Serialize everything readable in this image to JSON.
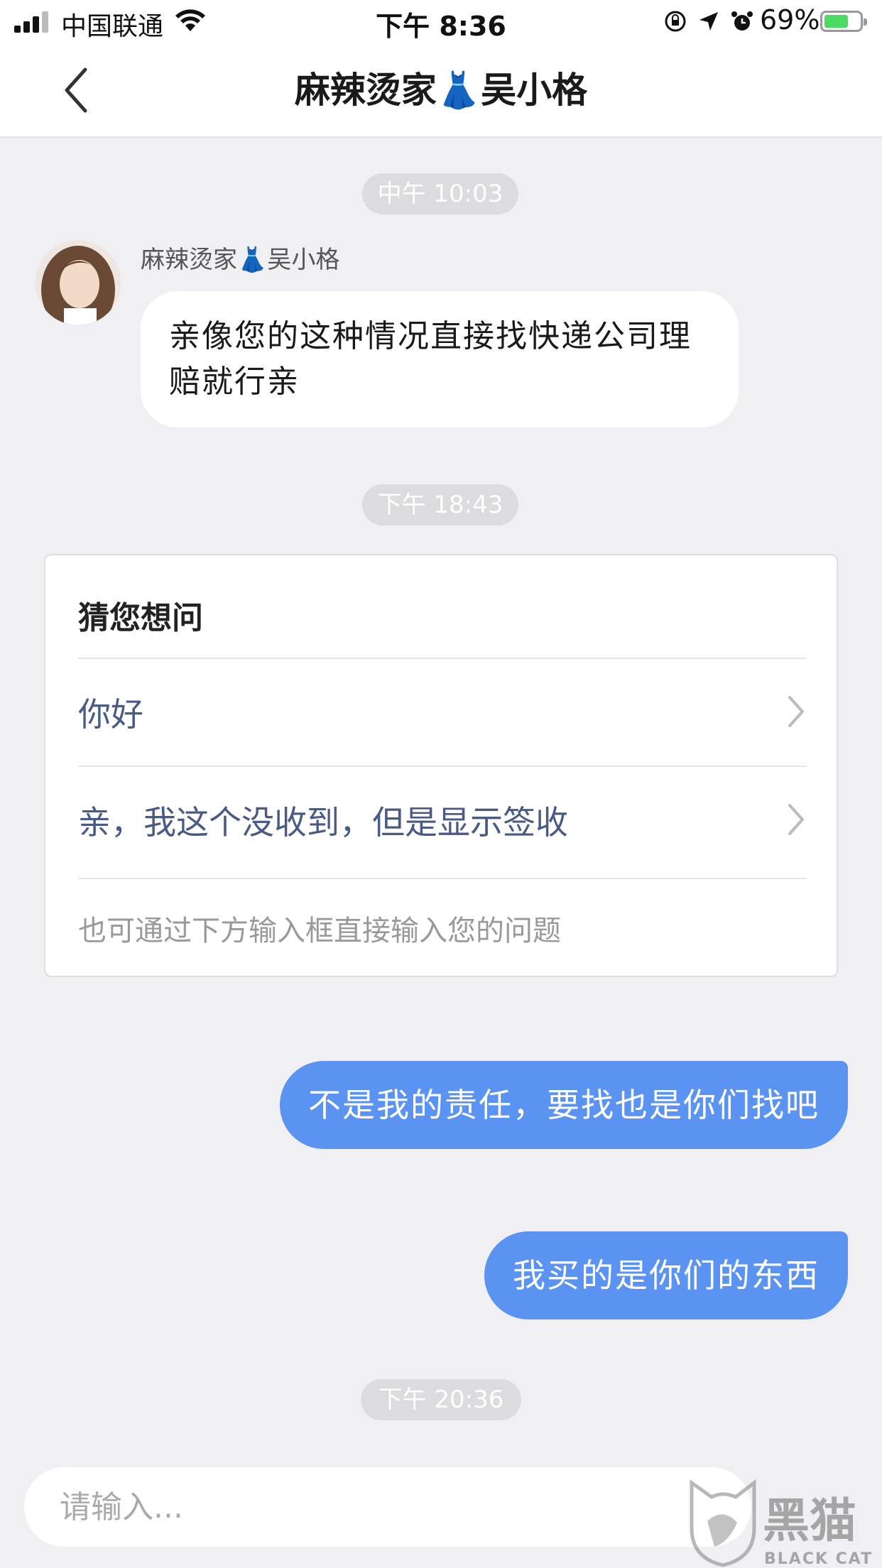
{
  "status_bar": {
    "carrier": "中国联通",
    "time": "下午 8:36",
    "battery": "69%",
    "battery_level": 0.69
  },
  "nav": {
    "title": "麻辣烫家👗吴小格"
  },
  "messages": {
    "time1": "中午 10:03",
    "sender": "麻辣烫家👗吴小格",
    "incoming_text": "亲像您的这种情况直接找快递公司理赔就行亲",
    "time2": "下午 18:43",
    "time3": "下午 20:36"
  },
  "faq_card": {
    "title": "猜您想问",
    "items": [
      {
        "label": "你好"
      },
      {
        "label": "亲，我这个没收到，但是显示签收"
      }
    ],
    "hint": "也可通过下方输入框直接输入您的问题"
  },
  "outgoing": [
    {
      "text": "不是我的责任，要找也是你们找吧"
    },
    {
      "text": "我买的是你们的东西"
    }
  ],
  "input": {
    "placeholder": "请输入..."
  },
  "watermark": {
    "text_cn": "黑猫",
    "text_en": "BLACK CAT"
  },
  "colors": {
    "accent": "#5a93f2",
    "background": "#efeff4",
    "link_text": "#4a5a86"
  }
}
